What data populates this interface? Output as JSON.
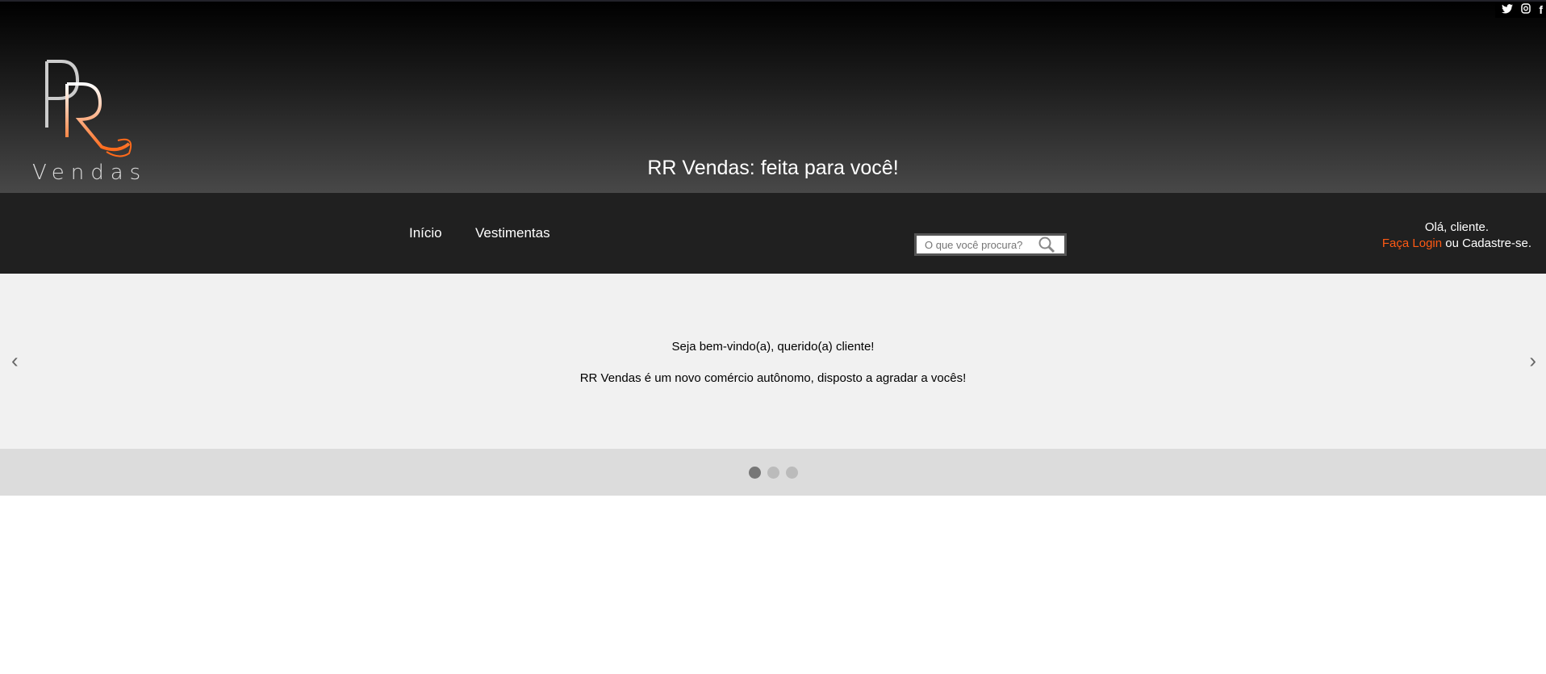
{
  "header": {
    "tagline": "RR Vendas: feita para você!",
    "logo_text": "RR Vendas",
    "social": [
      {
        "icon": "twitter-icon",
        "glyph": "🐦"
      },
      {
        "icon": "instagram-icon",
        "glyph": "◙"
      },
      {
        "icon": "facebook-icon",
        "glyph": "f"
      }
    ]
  },
  "nav": {
    "items": [
      {
        "label": "Início"
      },
      {
        "label": "Vestimentas"
      }
    ],
    "search_placeholder": "O que você procura?",
    "greeting": "Olá, cliente.",
    "login": "Faça Login",
    "or": " ou ",
    "register": "Cadastre-se."
  },
  "slider": {
    "line1": "Seja bem-vindo(a), querido(a) cliente!",
    "line2": "RR Vendas é um novo comércio autônomo, disposto a agradar a vocês!",
    "prev": "‹",
    "next": "›",
    "slides": 3,
    "active": 0
  },
  "colors": {
    "accent": "#ff5a14"
  }
}
